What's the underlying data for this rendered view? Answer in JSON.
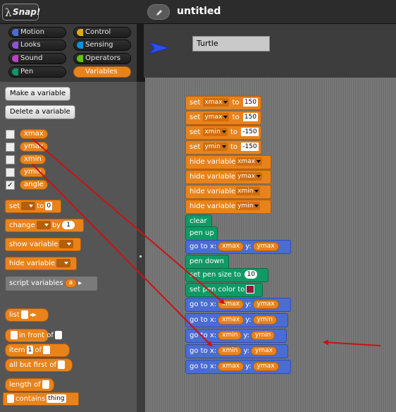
{
  "app": {
    "logo_text": "Snap!",
    "project_title": "untitled"
  },
  "categories": [
    {
      "label": "Motion",
      "color": "#4a6cd4"
    },
    {
      "label": "Control",
      "color": "#e1a91a"
    },
    {
      "label": "Looks",
      "color": "#8a55d7"
    },
    {
      "label": "Sensing",
      "color": "#0494dc"
    },
    {
      "label": "Sound",
      "color": "#bb42c3"
    },
    {
      "label": "Operators",
      "color": "#62c213"
    },
    {
      "label": "Pen",
      "color": "#0f9a65"
    },
    {
      "label": "Variables",
      "color": "#e8831b",
      "active": true
    }
  ],
  "palette": {
    "make_variable": "Make a variable",
    "delete_variable": "Delete a variable",
    "variables": [
      {
        "name": "xmax",
        "checked": false
      },
      {
        "name": "ymax",
        "checked": false
      },
      {
        "name": "xmin",
        "checked": false
      },
      {
        "name": "ymin",
        "checked": false
      },
      {
        "name": "angle",
        "checked": true
      }
    ],
    "check_mark": "✓",
    "blocks": {
      "set": "set",
      "set_to": "to",
      "set_value": "0",
      "change": "change",
      "change_by": "by",
      "change_value": "1",
      "show_variable": "show variable",
      "hide_variable": "hide variable",
      "script_variables": "script variables",
      "script_var_name": "a",
      "list": "list",
      "in_front_of": "in front of",
      "item": "item",
      "item_index": "1",
      "item_of": "of",
      "all_but_first": "all but first of",
      "length_of": "length of",
      "contains": "contains",
      "contains_value": "thing"
    }
  },
  "sprite": {
    "name": "Turtle"
  },
  "script": [
    {
      "type": "set",
      "var": "xmax",
      "to": "to",
      "value": "150"
    },
    {
      "type": "set",
      "var": "ymax",
      "to": "to",
      "value": "150"
    },
    {
      "type": "set",
      "var": "xmin",
      "to": "to",
      "value": "-150"
    },
    {
      "type": "set",
      "var": "ymin",
      "to": "to",
      "value": "-150"
    },
    {
      "type": "hide",
      "label": "hide variable",
      "var": "xmax"
    },
    {
      "type": "hide",
      "label": "hide variable",
      "var": "ymax"
    },
    {
      "type": "hide",
      "label": "hide variable",
      "var": "xmin"
    },
    {
      "type": "hide",
      "label": "hide variable",
      "var": "ymin"
    },
    {
      "type": "pen",
      "label": "clear"
    },
    {
      "type": "pen",
      "label": "pen up"
    },
    {
      "type": "goto",
      "label": "go to x:",
      "x": "xmax",
      "ylabel": "y:",
      "y": "ymax"
    },
    {
      "type": "pen",
      "label": "pen down"
    },
    {
      "type": "pensize",
      "label": "set pen size to",
      "value": "10"
    },
    {
      "type": "pencolor",
      "label": "set pen color to",
      "color": "#8b1c3c"
    },
    {
      "type": "goto",
      "label": "go to x:",
      "x": "xmax",
      "ylabel": "y:",
      "y": "ymax"
    },
    {
      "type": "goto",
      "label": "go to x:",
      "x": "xmax",
      "ylabel": "y:",
      "y": "ymin"
    },
    {
      "type": "goto",
      "label": "go to x:",
      "x": "xmin",
      "ylabel": "y:",
      "y": "ymin"
    },
    {
      "type": "goto",
      "label": "go to x:",
      "x": "xmin",
      "ylabel": "y:",
      "y": "ymax"
    },
    {
      "type": "goto",
      "label": "go to x:",
      "x": "xmax",
      "ylabel": "y:",
      "y": "ymax"
    }
  ],
  "annotation_color": "#cc1111"
}
